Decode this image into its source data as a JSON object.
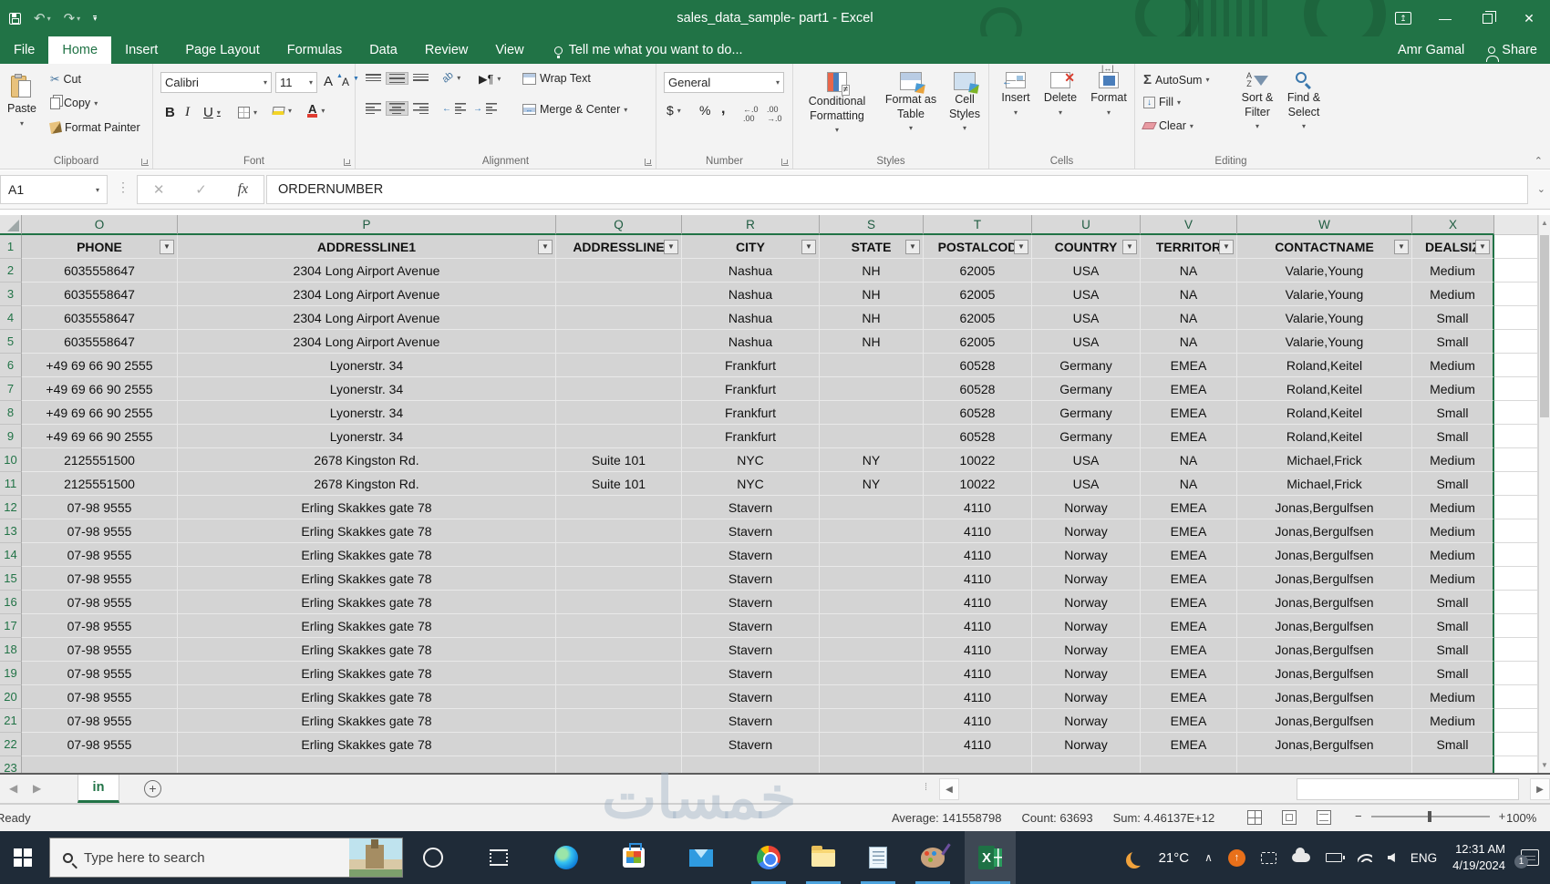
{
  "window": {
    "title": "sales_data_sample- part1 - Excel"
  },
  "tabs": {
    "items": [
      {
        "label": "File",
        "active": false
      },
      {
        "label": "Home",
        "active": true
      },
      {
        "label": "Insert",
        "active": false
      },
      {
        "label": "Page Layout",
        "active": false
      },
      {
        "label": "Formulas",
        "active": false
      },
      {
        "label": "Data",
        "active": false
      },
      {
        "label": "Review",
        "active": false
      },
      {
        "label": "View",
        "active": false
      }
    ],
    "tell_me": "Tell me what you want to do...",
    "user": "Amr Gamal",
    "share": "Share"
  },
  "ribbon": {
    "clipboard": {
      "label": "Clipboard",
      "paste": "Paste",
      "cut": "Cut",
      "copy": "Copy",
      "format_painter": "Format Painter"
    },
    "font": {
      "label": "Font",
      "family": "Calibri",
      "size": "11",
      "bold": "B",
      "italic": "I",
      "underline": "U"
    },
    "alignment": {
      "label": "Alignment",
      "wrap": "Wrap Text",
      "merge": "Merge & Center"
    },
    "number": {
      "label": "Number",
      "format": "General",
      "currency": "$",
      "percent": "%",
      "comma": ","
    },
    "styles": {
      "label": "Styles",
      "conditional": "Conditional Formatting",
      "format_table": "Format as Table",
      "cell_styles": "Cell Styles"
    },
    "cells": {
      "label": "Cells",
      "insert": "Insert",
      "delete": "Delete",
      "format": "Format"
    },
    "editing": {
      "label": "Editing",
      "autosum": "AutoSum",
      "fill": "Fill",
      "clear": "Clear",
      "sort": "Sort & Filter",
      "find": "Find & Select"
    }
  },
  "formula_bar": {
    "name_box": "A1",
    "fx": "fx",
    "content": "ORDERNUMBER"
  },
  "sheet": {
    "col_letters": [
      "O",
      "P",
      "Q",
      "R",
      "S",
      "T",
      "U",
      "V",
      "W",
      "X"
    ],
    "headers": [
      "PHONE",
      "ADDRESSLINE1",
      "ADDRESSLINE",
      "CITY",
      "STATE",
      "POSTALCOD",
      "COUNTRY",
      "TERRITOR",
      "CONTACTNAME",
      "DEALSIZ"
    ],
    "rows": [
      {
        "n": "2",
        "cells": [
          "6035558647",
          "2304 Long Airport Avenue",
          "",
          "Nashua",
          "NH",
          "62005",
          "USA",
          "NA",
          "Valarie,Young",
          "Medium"
        ]
      },
      {
        "n": "3",
        "cells": [
          "6035558647",
          "2304 Long Airport Avenue",
          "",
          "Nashua",
          "NH",
          "62005",
          "USA",
          "NA",
          "Valarie,Young",
          "Medium"
        ]
      },
      {
        "n": "4",
        "cells": [
          "6035558647",
          "2304 Long Airport Avenue",
          "",
          "Nashua",
          "NH",
          "62005",
          "USA",
          "NA",
          "Valarie,Young",
          "Small"
        ]
      },
      {
        "n": "5",
        "cells": [
          "6035558647",
          "2304 Long Airport Avenue",
          "",
          "Nashua",
          "NH",
          "62005",
          "USA",
          "NA",
          "Valarie,Young",
          "Small"
        ]
      },
      {
        "n": "6",
        "cells": [
          "+49 69 66 90 2555",
          "Lyonerstr. 34",
          "",
          "Frankfurt",
          "",
          "60528",
          "Germany",
          "EMEA",
          "Roland,Keitel",
          "Medium"
        ]
      },
      {
        "n": "7",
        "cells": [
          "+49 69 66 90 2555",
          "Lyonerstr. 34",
          "",
          "Frankfurt",
          "",
          "60528",
          "Germany",
          "EMEA",
          "Roland,Keitel",
          "Medium"
        ]
      },
      {
        "n": "8",
        "cells": [
          "+49 69 66 90 2555",
          "Lyonerstr. 34",
          "",
          "Frankfurt",
          "",
          "60528",
          "Germany",
          "EMEA",
          "Roland,Keitel",
          "Small"
        ]
      },
      {
        "n": "9",
        "cells": [
          "+49 69 66 90 2555",
          "Lyonerstr. 34",
          "",
          "Frankfurt",
          "",
          "60528",
          "Germany",
          "EMEA",
          "Roland,Keitel",
          "Small"
        ]
      },
      {
        "n": "10",
        "cells": [
          "2125551500",
          "2678 Kingston Rd.",
          "Suite 101",
          "NYC",
          "NY",
          "10022",
          "USA",
          "NA",
          "Michael,Frick",
          "Medium"
        ]
      },
      {
        "n": "11",
        "cells": [
          "2125551500",
          "2678 Kingston Rd.",
          "Suite 101",
          "NYC",
          "NY",
          "10022",
          "USA",
          "NA",
          "Michael,Frick",
          "Small"
        ]
      },
      {
        "n": "12",
        "cells": [
          "07-98 9555",
          "Erling Skakkes gate 78",
          "",
          "Stavern",
          "",
          "4110",
          "Norway",
          "EMEA",
          "Jonas,Bergulfsen",
          "Medium"
        ]
      },
      {
        "n": "13",
        "cells": [
          "07-98 9555",
          "Erling Skakkes gate 78",
          "",
          "Stavern",
          "",
          "4110",
          "Norway",
          "EMEA",
          "Jonas,Bergulfsen",
          "Medium"
        ]
      },
      {
        "n": "14",
        "cells": [
          "07-98 9555",
          "Erling Skakkes gate 78",
          "",
          "Stavern",
          "",
          "4110",
          "Norway",
          "EMEA",
          "Jonas,Bergulfsen",
          "Medium"
        ]
      },
      {
        "n": "15",
        "cells": [
          "07-98 9555",
          "Erling Skakkes gate 78",
          "",
          "Stavern",
          "",
          "4110",
          "Norway",
          "EMEA",
          "Jonas,Bergulfsen",
          "Medium"
        ]
      },
      {
        "n": "16",
        "cells": [
          "07-98 9555",
          "Erling Skakkes gate 78",
          "",
          "Stavern",
          "",
          "4110",
          "Norway",
          "EMEA",
          "Jonas,Bergulfsen",
          "Small"
        ]
      },
      {
        "n": "17",
        "cells": [
          "07-98 9555",
          "Erling Skakkes gate 78",
          "",
          "Stavern",
          "",
          "4110",
          "Norway",
          "EMEA",
          "Jonas,Bergulfsen",
          "Small"
        ]
      },
      {
        "n": "18",
        "cells": [
          "07-98 9555",
          "Erling Skakkes gate 78",
          "",
          "Stavern",
          "",
          "4110",
          "Norway",
          "EMEA",
          "Jonas,Bergulfsen",
          "Small"
        ]
      },
      {
        "n": "19",
        "cells": [
          "07-98 9555",
          "Erling Skakkes gate 78",
          "",
          "Stavern",
          "",
          "4110",
          "Norway",
          "EMEA",
          "Jonas,Bergulfsen",
          "Small"
        ]
      },
      {
        "n": "20",
        "cells": [
          "07-98 9555",
          "Erling Skakkes gate 78",
          "",
          "Stavern",
          "",
          "4110",
          "Norway",
          "EMEA",
          "Jonas,Bergulfsen",
          "Medium"
        ]
      },
      {
        "n": "21",
        "cells": [
          "07-98 9555",
          "Erling Skakkes gate 78",
          "",
          "Stavern",
          "",
          "4110",
          "Norway",
          "EMEA",
          "Jonas,Bergulfsen",
          "Medium"
        ]
      },
      {
        "n": "22",
        "cells": [
          "07-98 9555",
          "Erling Skakkes gate 78",
          "",
          "Stavern",
          "",
          "4110",
          "Norway",
          "EMEA",
          "Jonas,Bergulfsen",
          "Small"
        ]
      }
    ]
  },
  "tab_strip": {
    "sheet_name": "in"
  },
  "status_bar": {
    "mode": "Ready",
    "aggregates": [
      {
        "label": "Average:",
        "value": "141558798"
      },
      {
        "label": "Count:",
        "value": "63693"
      },
      {
        "label": "Sum:",
        "value": "4.46137E+12"
      }
    ],
    "zoom": "100%"
  },
  "taskbar": {
    "search_placeholder": "Type here to search",
    "temp": "21°C",
    "lang": "ENG",
    "time": "12:31 AM",
    "date": "4/19/2024",
    "badge": "1"
  },
  "watermark": "خمسات",
  "colors": {
    "excel_green": "#217346",
    "selection_gray": "#d4d4d4",
    "taskbar_dark": "#1f2b38"
  }
}
